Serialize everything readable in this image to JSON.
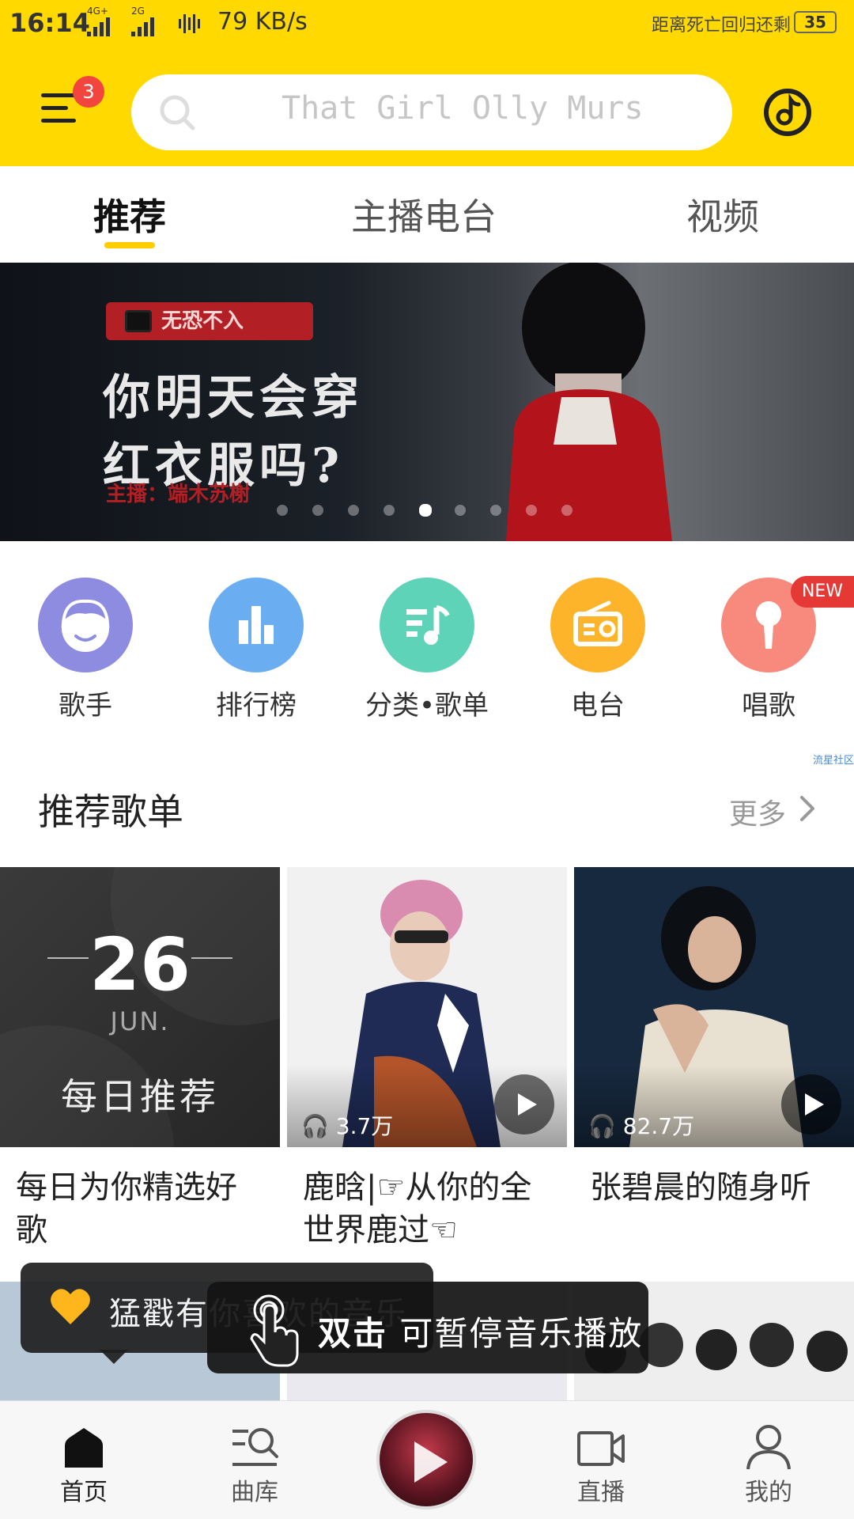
{
  "status_bar": {
    "time": "16:14",
    "network_1": "4G+",
    "network_2": "2G",
    "speed": "79 KB/s",
    "countdown": "距离死亡回归还剩",
    "battery": "35"
  },
  "header": {
    "menu_badge": "3",
    "search_placeholder": "That Girl Olly Murs",
    "accent_color": "#FFD900"
  },
  "tabs": [
    {
      "label": "推荐",
      "active": true
    },
    {
      "label": "主播电台",
      "active": false
    },
    {
      "label": "视频",
      "active": false
    }
  ],
  "banner": {
    "tag": "无恐不入",
    "headline_line1": "你明天会穿",
    "headline_line2": "红衣服吗?",
    "host": "主播：端木苏榭",
    "dots_count": 9,
    "active_dot": 5
  },
  "quick_links": [
    {
      "label": "歌手",
      "icon": "singer-icon",
      "color": "#8E8CE0"
    },
    {
      "label": "排行榜",
      "icon": "chart-bars-icon",
      "color": "#6AAEF1"
    },
    {
      "label": "分类•歌单",
      "icon": "playlist-category-icon",
      "color": "#5ED3B7"
    },
    {
      "label": "电台",
      "icon": "radio-icon",
      "color": "#FDB42B"
    },
    {
      "label": "唱歌",
      "icon": "microphone-icon",
      "color": "#F7897D"
    }
  ],
  "new_badge": "NEW",
  "ad_mark": "流星社区",
  "section": {
    "title": "推荐歌单",
    "more": "更多"
  },
  "playlists": [
    {
      "day": "26",
      "month": "JUN.",
      "label": "每日推荐",
      "title": "每日为你精选好歌"
    },
    {
      "plays": "3.7万",
      "title": "鹿晗|☞从你的全世界鹿过☜"
    },
    {
      "plays": "82.7万",
      "title": "张碧晨的随身听"
    }
  ],
  "toasts": {
    "like_hint": "猛戳有你喜欢的音乐",
    "double_tap_bold": "双击",
    "double_tap_rest": " 可暂停音乐播放"
  },
  "bottom_nav": [
    {
      "label": "首页",
      "icon": "home-icon",
      "active": true
    },
    {
      "label": "曲库",
      "icon": "library-search-icon",
      "active": false
    },
    {
      "label": "",
      "icon": "play-icon",
      "active": false
    },
    {
      "label": "直播",
      "icon": "video-camera-icon",
      "active": false
    },
    {
      "label": "我的",
      "icon": "person-icon",
      "active": false
    }
  ]
}
